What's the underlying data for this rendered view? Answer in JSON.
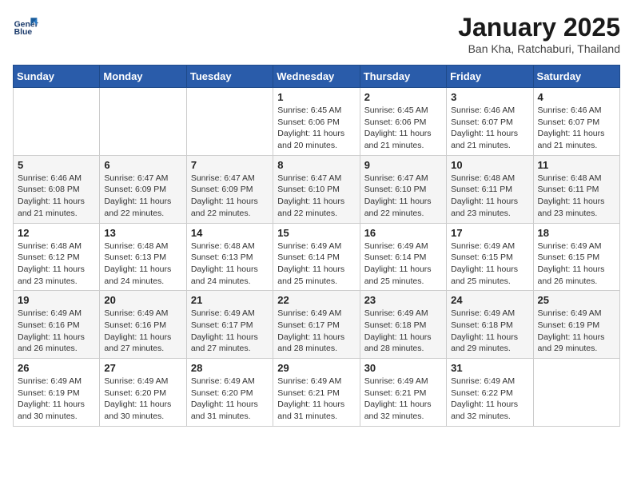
{
  "header": {
    "logo_line1": "General",
    "logo_line2": "Blue",
    "month": "January 2025",
    "location": "Ban Kha, Ratchaburi, Thailand"
  },
  "weekdays": [
    "Sunday",
    "Monday",
    "Tuesday",
    "Wednesday",
    "Thursday",
    "Friday",
    "Saturday"
  ],
  "weeks": [
    [
      {
        "day": "",
        "info": ""
      },
      {
        "day": "",
        "info": ""
      },
      {
        "day": "",
        "info": ""
      },
      {
        "day": "1",
        "info": "Sunrise: 6:45 AM\nSunset: 6:06 PM\nDaylight: 11 hours and 20 minutes."
      },
      {
        "day": "2",
        "info": "Sunrise: 6:45 AM\nSunset: 6:06 PM\nDaylight: 11 hours and 21 minutes."
      },
      {
        "day": "3",
        "info": "Sunrise: 6:46 AM\nSunset: 6:07 PM\nDaylight: 11 hours and 21 minutes."
      },
      {
        "day": "4",
        "info": "Sunrise: 6:46 AM\nSunset: 6:07 PM\nDaylight: 11 hours and 21 minutes."
      }
    ],
    [
      {
        "day": "5",
        "info": "Sunrise: 6:46 AM\nSunset: 6:08 PM\nDaylight: 11 hours and 21 minutes."
      },
      {
        "day": "6",
        "info": "Sunrise: 6:47 AM\nSunset: 6:09 PM\nDaylight: 11 hours and 22 minutes."
      },
      {
        "day": "7",
        "info": "Sunrise: 6:47 AM\nSunset: 6:09 PM\nDaylight: 11 hours and 22 minutes."
      },
      {
        "day": "8",
        "info": "Sunrise: 6:47 AM\nSunset: 6:10 PM\nDaylight: 11 hours and 22 minutes."
      },
      {
        "day": "9",
        "info": "Sunrise: 6:47 AM\nSunset: 6:10 PM\nDaylight: 11 hours and 22 minutes."
      },
      {
        "day": "10",
        "info": "Sunrise: 6:48 AM\nSunset: 6:11 PM\nDaylight: 11 hours and 23 minutes."
      },
      {
        "day": "11",
        "info": "Sunrise: 6:48 AM\nSunset: 6:11 PM\nDaylight: 11 hours and 23 minutes."
      }
    ],
    [
      {
        "day": "12",
        "info": "Sunrise: 6:48 AM\nSunset: 6:12 PM\nDaylight: 11 hours and 23 minutes."
      },
      {
        "day": "13",
        "info": "Sunrise: 6:48 AM\nSunset: 6:13 PM\nDaylight: 11 hours and 24 minutes."
      },
      {
        "day": "14",
        "info": "Sunrise: 6:48 AM\nSunset: 6:13 PM\nDaylight: 11 hours and 24 minutes."
      },
      {
        "day": "15",
        "info": "Sunrise: 6:49 AM\nSunset: 6:14 PM\nDaylight: 11 hours and 25 minutes."
      },
      {
        "day": "16",
        "info": "Sunrise: 6:49 AM\nSunset: 6:14 PM\nDaylight: 11 hours and 25 minutes."
      },
      {
        "day": "17",
        "info": "Sunrise: 6:49 AM\nSunset: 6:15 PM\nDaylight: 11 hours and 25 minutes."
      },
      {
        "day": "18",
        "info": "Sunrise: 6:49 AM\nSunset: 6:15 PM\nDaylight: 11 hours and 26 minutes."
      }
    ],
    [
      {
        "day": "19",
        "info": "Sunrise: 6:49 AM\nSunset: 6:16 PM\nDaylight: 11 hours and 26 minutes."
      },
      {
        "day": "20",
        "info": "Sunrise: 6:49 AM\nSunset: 6:16 PM\nDaylight: 11 hours and 27 minutes."
      },
      {
        "day": "21",
        "info": "Sunrise: 6:49 AM\nSunset: 6:17 PM\nDaylight: 11 hours and 27 minutes."
      },
      {
        "day": "22",
        "info": "Sunrise: 6:49 AM\nSunset: 6:17 PM\nDaylight: 11 hours and 28 minutes."
      },
      {
        "day": "23",
        "info": "Sunrise: 6:49 AM\nSunset: 6:18 PM\nDaylight: 11 hours and 28 minutes."
      },
      {
        "day": "24",
        "info": "Sunrise: 6:49 AM\nSunset: 6:18 PM\nDaylight: 11 hours and 29 minutes."
      },
      {
        "day": "25",
        "info": "Sunrise: 6:49 AM\nSunset: 6:19 PM\nDaylight: 11 hours and 29 minutes."
      }
    ],
    [
      {
        "day": "26",
        "info": "Sunrise: 6:49 AM\nSunset: 6:19 PM\nDaylight: 11 hours and 30 minutes."
      },
      {
        "day": "27",
        "info": "Sunrise: 6:49 AM\nSunset: 6:20 PM\nDaylight: 11 hours and 30 minutes."
      },
      {
        "day": "28",
        "info": "Sunrise: 6:49 AM\nSunset: 6:20 PM\nDaylight: 11 hours and 31 minutes."
      },
      {
        "day": "29",
        "info": "Sunrise: 6:49 AM\nSunset: 6:21 PM\nDaylight: 11 hours and 31 minutes."
      },
      {
        "day": "30",
        "info": "Sunrise: 6:49 AM\nSunset: 6:21 PM\nDaylight: 11 hours and 32 minutes."
      },
      {
        "day": "31",
        "info": "Sunrise: 6:49 AM\nSunset: 6:22 PM\nDaylight: 11 hours and 32 minutes."
      },
      {
        "day": "",
        "info": ""
      }
    ]
  ]
}
